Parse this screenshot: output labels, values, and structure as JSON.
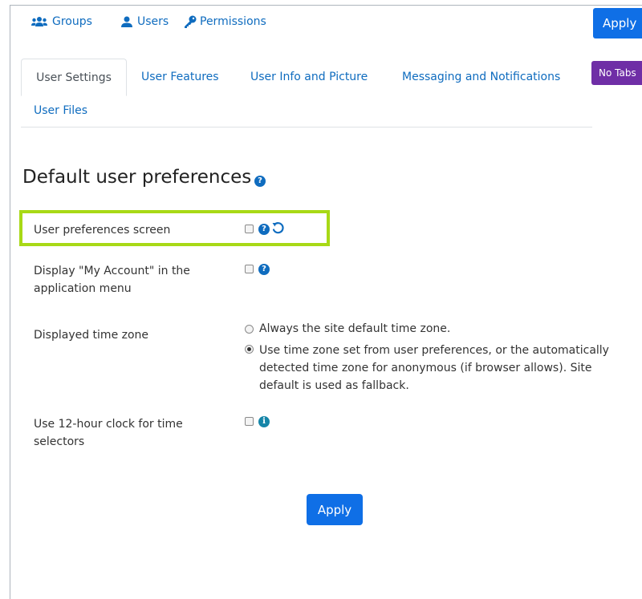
{
  "top_nav": {
    "groups": "Groups",
    "users": "Users",
    "permissions": "Permissions",
    "apply": "Apply"
  },
  "tabs": {
    "items": [
      {
        "label": "User Settings",
        "active": true
      },
      {
        "label": "User Features"
      },
      {
        "label": "User Info and Picture"
      },
      {
        "label": "Messaging and Notifications"
      },
      {
        "label": "User Files"
      }
    ],
    "no_tabs": "No Tabs"
  },
  "section": {
    "title": "Default user preferences"
  },
  "settings": {
    "user_pref_screen": "User preferences screen",
    "display_my_account_line1": "Display \"My Account\" in the",
    "display_my_account_line2": "application menu",
    "time_zone_label": "Displayed time zone",
    "tz_option1": "Always the site default time zone.",
    "tz_option2_line1": "Use time zone set from user preferences, or the automatically",
    "tz_option2_line2": "detected time zone for anonymous (if browser allows). Site",
    "tz_option2_line3": "default is used as fallback.",
    "clock_line1": "Use 12-hour clock for time",
    "clock_line2": "selectors"
  },
  "footer": {
    "apply": "Apply"
  },
  "colors": {
    "link": "#0f6cbf",
    "primary_button": "#0f6fe6",
    "no_tabs_button": "#6f2ea6",
    "highlight": "#a8d916"
  }
}
